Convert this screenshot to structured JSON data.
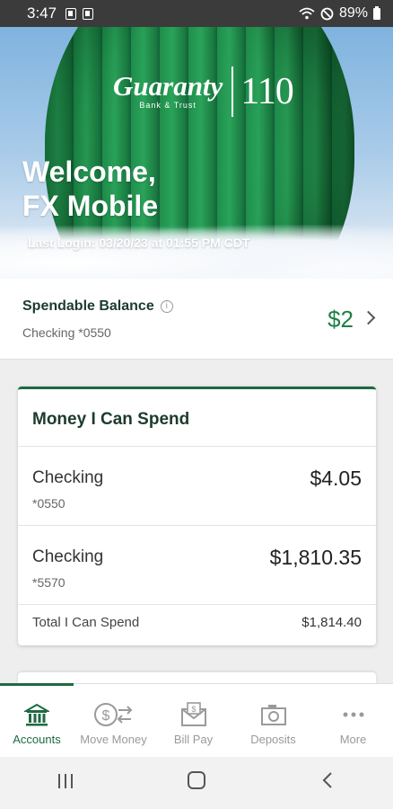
{
  "status_bar": {
    "time": "3:47",
    "battery": "89%"
  },
  "hero": {
    "logo_brand": "Guaranty",
    "logo_sub": "Bank & Trust",
    "logo_number": "110",
    "welcome_line1": "Welcome,",
    "welcome_line2": "FX Mobile",
    "last_login": "Last Login: 03/20/23 at 01:55 PM CDT"
  },
  "spendable": {
    "title": "Spendable Balance",
    "account": "Checking *0550",
    "amount": "$2"
  },
  "money_card": {
    "title": "Money I Can Spend",
    "accounts": [
      {
        "name": "Checking",
        "number": "*0550",
        "balance": "$4.05"
      },
      {
        "name": "Checking",
        "number": "*5570",
        "balance": "$1,810.35"
      }
    ],
    "total_label": "Total I Can Spend",
    "total_value": "$1,814.40"
  },
  "bottom_nav": {
    "items": [
      {
        "label": "Accounts",
        "icon": "bank-icon",
        "active": true
      },
      {
        "label": "Move Money",
        "icon": "transfer-icon"
      },
      {
        "label": "Bill Pay",
        "icon": "bill-envelope-icon"
      },
      {
        "label": "Deposits",
        "icon": "camera-icon"
      },
      {
        "label": "More",
        "icon": "more-dots-icon"
      }
    ]
  },
  "colors": {
    "brand_green": "#1e6a42",
    "amount_green": "#1e7f45"
  }
}
